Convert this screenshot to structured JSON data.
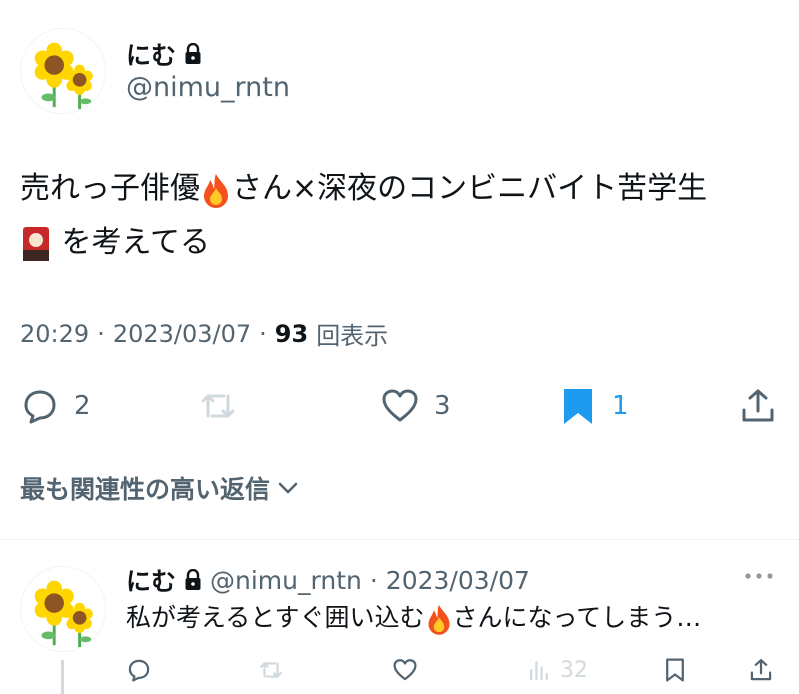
{
  "tweet": {
    "display_name": "にむ",
    "handle": "@nimu_rntn",
    "text_line1": "売れっ子俳優",
    "text_line1b": "さん×深夜のコンビニバイト苦学生",
    "text_line2": "を考えてる",
    "time": "20:29",
    "date": "2023/03/07",
    "views_count": "93",
    "views_label": "回表示",
    "replies": "2",
    "likes": "3",
    "bookmarks": "1"
  },
  "sort_label": "最も関連性の高い返信",
  "reply": {
    "display_name": "にむ",
    "handle": "@nimu_rntn",
    "date": "2023/03/07",
    "text_a": "私が考えるとすぐ囲い込む",
    "text_b": "さんになってしまう…",
    "views": "32"
  },
  "colors": {
    "bookmark_accent": "#1d9bf0",
    "muted": "#536471"
  }
}
